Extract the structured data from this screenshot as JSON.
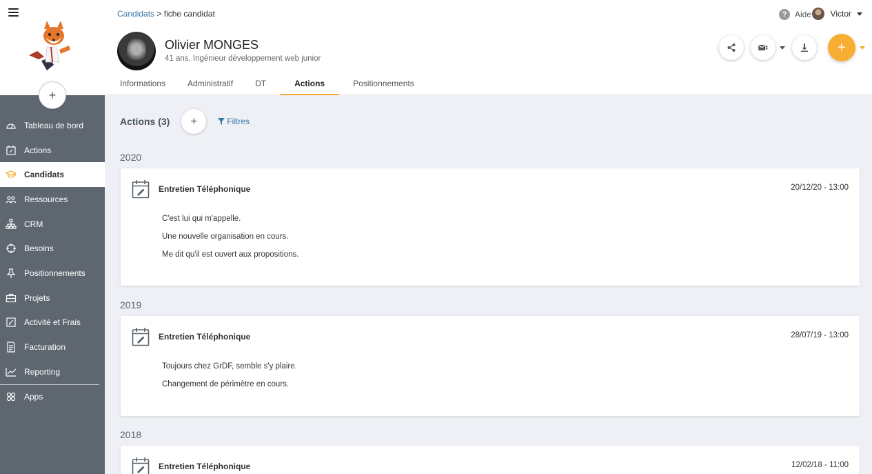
{
  "sidebar": {
    "items": [
      {
        "label": "Tableau de bord",
        "icon": "dashboard-icon"
      },
      {
        "label": "Actions",
        "icon": "edit-calendar-icon"
      },
      {
        "label": "Candidats",
        "icon": "graduation-cap-icon",
        "active": true
      },
      {
        "label": "Ressources",
        "icon": "people-icon"
      },
      {
        "label": "CRM",
        "icon": "org-chart-icon"
      },
      {
        "label": "Besoins",
        "icon": "target-icon"
      },
      {
        "label": "Positionnements",
        "icon": "pin-icon"
      },
      {
        "label": "Projets",
        "icon": "briefcase-icon"
      },
      {
        "label": "Activité et Frais",
        "icon": "edit-icon"
      },
      {
        "label": "Facturation",
        "icon": "invoice-icon"
      },
      {
        "label": "Reporting",
        "icon": "chart-icon"
      },
      {
        "label": "Apps",
        "icon": "apps-icon"
      }
    ],
    "add_label": "+"
  },
  "header": {
    "breadcrumb": {
      "parent": "Candidats",
      "separator": " > ",
      "current": "fiche candidat"
    },
    "help_label": "Aide",
    "user_name": "Victor",
    "candidate_name": "Olivier MONGES",
    "candidate_subtitle": "41 ans, Ingénieur développement web junior",
    "main_add_label": "+",
    "accent_color": "#f8ae33",
    "tabs": [
      {
        "label": "Informations"
      },
      {
        "label": "Administratif"
      },
      {
        "label": "DT"
      },
      {
        "label": "Actions",
        "active": true
      },
      {
        "label": "Positionnements"
      }
    ]
  },
  "main": {
    "title": "Actions (3)",
    "add_label": "+",
    "filters_label": "Filtres",
    "groups": [
      {
        "year": "2020",
        "card": {
          "title": "Entretien Téléphonique",
          "date": "20/12/20 - 13:00",
          "lines": [
            "C'est lui qui m'appelle.",
            "Une nouvelle organisation en cours.",
            "Me dit qu'il est ouvert aux propositions."
          ]
        }
      },
      {
        "year": "2019",
        "card": {
          "title": "Entretien Téléphonique",
          "date": "28/07/19 - 13:00",
          "lines": [
            "Toujours chez GrDF, semble s'y plaire.",
            "Changement de périmètre en cours."
          ]
        }
      },
      {
        "year": "2018",
        "card": {
          "title": "Entretien Téléphonique",
          "date": "12/02/18 - 11:00",
          "lines": []
        }
      }
    ]
  }
}
